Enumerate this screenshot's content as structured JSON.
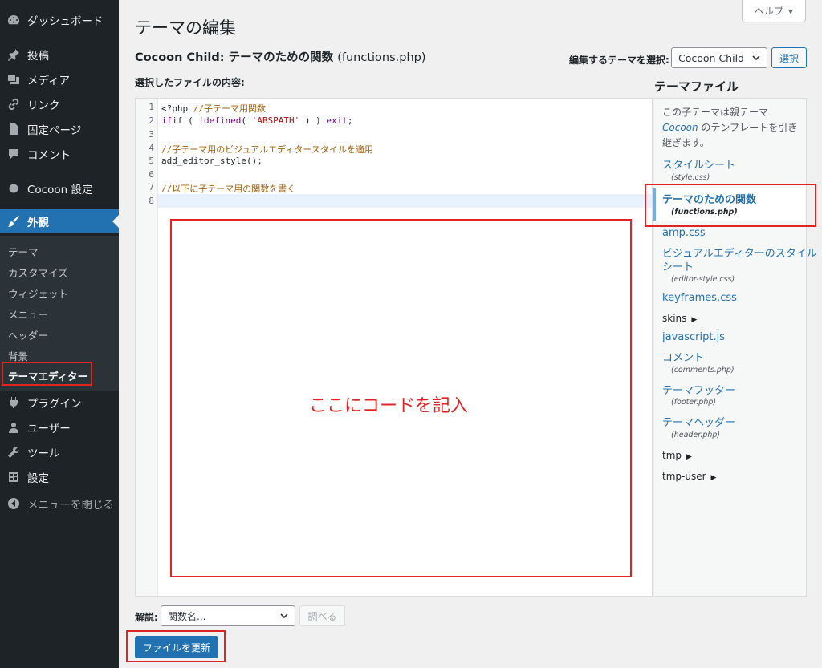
{
  "sidebar": {
    "items": [
      {
        "label": "ダッシュボード",
        "icon": "dashboard-icon"
      },
      {
        "label": "投稿",
        "icon": "pin-icon"
      },
      {
        "label": "メディア",
        "icon": "media-icon"
      },
      {
        "label": "リンク",
        "icon": "link-icon"
      },
      {
        "label": "固定ページ",
        "icon": "page-icon"
      },
      {
        "label": "コメント",
        "icon": "comment-icon"
      },
      {
        "label": "Cocoon 設定",
        "icon": "circle-icon"
      },
      {
        "label": "外観",
        "icon": "appearance-icon"
      },
      {
        "label": "プラグイン",
        "icon": "plugin-icon"
      },
      {
        "label": "ユーザー",
        "icon": "user-icon"
      },
      {
        "label": "ツール",
        "icon": "wrench-icon"
      },
      {
        "label": "設定",
        "icon": "settings-icon"
      },
      {
        "label": "メニューを閉じる",
        "icon": "collapse-icon"
      }
    ],
    "submenu": [
      "テーマ",
      "カスタマイズ",
      "ウィジェット",
      "メニュー",
      "ヘッダー",
      "背景",
      "テーマエディター"
    ]
  },
  "header": {
    "help": "ヘルプ",
    "title": "テーマの編集",
    "theme_name": "Cocoon Child:",
    "file_title": "テーマのための関数",
    "file_path": "(functions.php)",
    "select_label": "編集するテーマを選択:",
    "selected_theme": "Cocoon Child",
    "select_button": "選択",
    "content_label": "選択したファイルの内容:"
  },
  "editor": {
    "line_numbers": [
      "1",
      "2",
      "3",
      "4",
      "5",
      "6",
      "7",
      "8"
    ],
    "lines": {
      "l1a": "<?php ",
      "l1b": "//子テーマ用関数",
      "l2a": "if ( !",
      "l2b": "defined",
      "l2c": "( ",
      "l2d": "'ABSPATH'",
      "l2e": " ) ) ",
      "l2f": "exit",
      "l2g": ";",
      "l4": "//子テーマ用のビジュアルエディタースタイルを適用",
      "l5": "add_editor_style();",
      "l7": "//以下に子テーマ用の関数を書く"
    },
    "placeholder": "ここにコードを記入"
  },
  "files": {
    "title": "テーマファイル",
    "note_before": "この子テーマは親テーマ ",
    "note_parent": "Cocoon",
    "note_after": " のテンプレートを引き継ぎます。",
    "list": [
      {
        "label": "スタイルシート",
        "sub": "(style.css)"
      },
      {
        "label": "テーマのための関数",
        "sub": "(functions.php)"
      },
      {
        "label": "amp.css"
      },
      {
        "label": "ビジュアルエディターのスタイル",
        "label2": "シート",
        "sub": "(editor-style.css)"
      },
      {
        "label": "keyframes.css"
      },
      {
        "label": "skins"
      },
      {
        "label": "javascript.js"
      },
      {
        "label": "コメント",
        "sub": "(comments.php)"
      },
      {
        "label": "テーマフッター",
        "sub": "(footer.php)"
      },
      {
        "label": "テーマヘッダー",
        "sub": "(header.php)"
      },
      {
        "label": "tmp"
      },
      {
        "label": "tmp-user"
      }
    ]
  },
  "footer": {
    "doc_label": "解説:",
    "doc_placeholder": "関数名...",
    "lookup_button": "調べる",
    "update_button": "ファイルを更新"
  },
  "colors": {
    "sidebar_bg": "#1d2327",
    "accent": "#2271b1",
    "annotation_red": "#e02424"
  }
}
